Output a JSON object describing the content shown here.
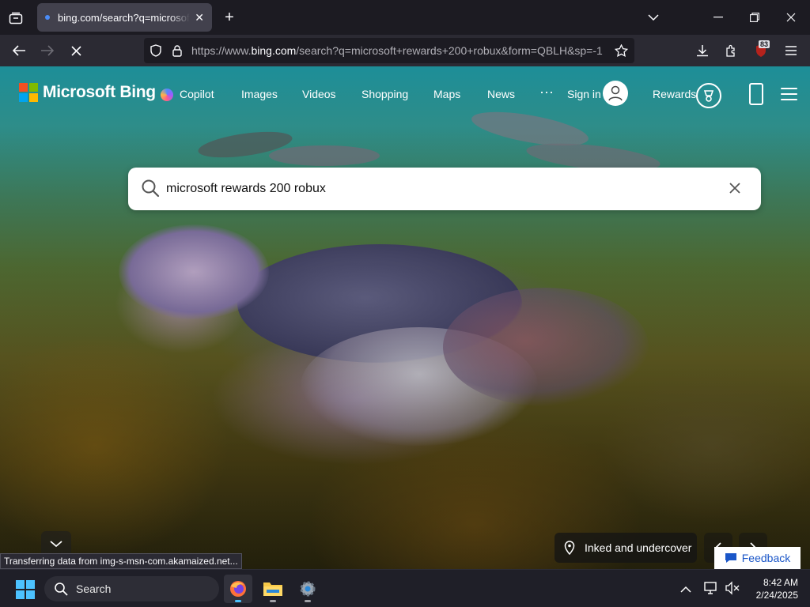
{
  "browser": {
    "tab": {
      "title": "bing.com/search?q=microsoft+rewards+200+robux"
    },
    "url": {
      "prefix": "https://www.",
      "domain": "bing.com",
      "rest": "/search?q=microsoft+rewards+200+robux&form=QBLH&sp=-1"
    },
    "extension_badge": "83",
    "status_text": "Transferring data from img-s-msn-com.akamaized.net..."
  },
  "bing": {
    "brand": "Microsoft Bing",
    "nav": [
      "Copilot",
      "Images",
      "Videos",
      "Shopping",
      "Maps",
      "News"
    ],
    "more": "···",
    "sign_in": "Sign in",
    "rewards": "Rewards",
    "search_value": "microsoft rewards 200 robux",
    "image_caption": "Inked and undercover",
    "feedback": "Feedback",
    "logo_colors": [
      "#f25022",
      "#7fba00",
      "#00a4ef",
      "#ffb900"
    ]
  },
  "taskbar": {
    "search_label": "Search",
    "time": "8:42 AM",
    "date": "2/24/2025"
  }
}
